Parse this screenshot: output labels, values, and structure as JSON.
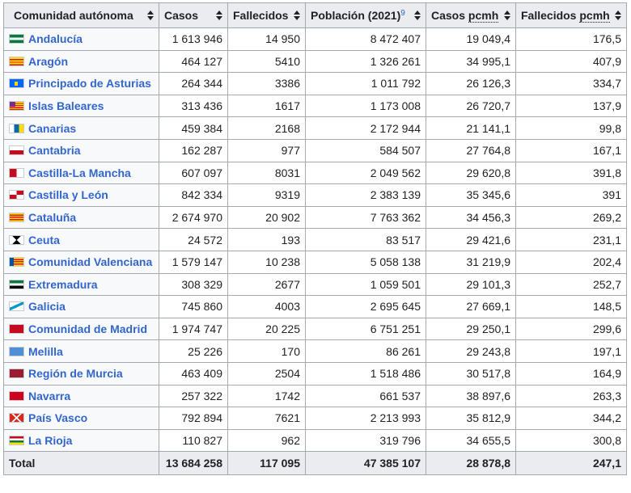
{
  "table": {
    "headers": [
      {
        "label": "Comunidad autónoma",
        "sup": "",
        "abbr": ""
      },
      {
        "label": "Casos",
        "sup": "",
        "abbr": ""
      },
      {
        "label": "Fallecidos",
        "sup": "",
        "abbr": ""
      },
      {
        "label": "Población (2021)",
        "sup": "9",
        "abbr": ""
      },
      {
        "label": "Casos ",
        "sup": "",
        "abbr": "pcmh"
      },
      {
        "label": "Fallecidos ",
        "sup": "",
        "abbr": "pcmh"
      }
    ],
    "rows": [
      {
        "flag": "andalucia-flag-icon",
        "flag_class": "f-andalucia",
        "name": "Andalucía",
        "casos": "1 613 946",
        "fallecidos": "14 950",
        "poblacion": "8 472 407",
        "casos_pcmh": "19 049,4",
        "fallecidos_pcmh": "176,5"
      },
      {
        "flag": "aragon-flag-icon",
        "flag_class": "f-aragon",
        "name": "Aragón",
        "casos": "464 127",
        "fallecidos": "5410",
        "poblacion": "1 326 261",
        "casos_pcmh": "34 995,1",
        "fallecidos_pcmh": "407,9"
      },
      {
        "flag": "asturias-flag-icon",
        "flag_class": "f-asturias",
        "name": "Principado de Asturias",
        "casos": "264 344",
        "fallecidos": "3386",
        "poblacion": "1 011 792",
        "casos_pcmh": "26 126,3",
        "fallecidos_pcmh": "334,7"
      },
      {
        "flag": "baleares-flag-icon",
        "flag_class": "f-baleares",
        "name": "Islas Baleares",
        "casos": "313 436",
        "fallecidos": "1617",
        "poblacion": "1 173 008",
        "casos_pcmh": "26 720,7",
        "fallecidos_pcmh": "137,9"
      },
      {
        "flag": "canarias-flag-icon",
        "flag_class": "f-canarias",
        "name": "Canarias",
        "casos": "459 384",
        "fallecidos": "2168",
        "poblacion": "2 172 944",
        "casos_pcmh": "21 141,1",
        "fallecidos_pcmh": "99,8"
      },
      {
        "flag": "cantabria-flag-icon",
        "flag_class": "f-cantabria",
        "name": "Cantabria",
        "casos": "162 287",
        "fallecidos": "977",
        "poblacion": "584 507",
        "casos_pcmh": "27 764,8",
        "fallecidos_pcmh": "167,1"
      },
      {
        "flag": "castilla-la-mancha-flag-icon",
        "flag_class": "f-clm",
        "name": "Castilla-La Mancha",
        "casos": "607 097",
        "fallecidos": "8031",
        "poblacion": "2 049 562",
        "casos_pcmh": "29 620,8",
        "fallecidos_pcmh": "391,8"
      },
      {
        "flag": "castilla-y-leon-flag-icon",
        "flag_class": "f-cyl",
        "name": "Castilla y León",
        "casos": "842 334",
        "fallecidos": "9319",
        "poblacion": "2 383 139",
        "casos_pcmh": "35 345,6",
        "fallecidos_pcmh": "391"
      },
      {
        "flag": "cataluna-flag-icon",
        "flag_class": "f-cataluna",
        "name": "Cataluña",
        "casos": "2 674 970",
        "fallecidos": "20 902",
        "poblacion": "7 763 362",
        "casos_pcmh": "34 456,3",
        "fallecidos_pcmh": "269,2"
      },
      {
        "flag": "ceuta-flag-icon",
        "flag_class": "f-ceuta",
        "name": "Ceuta",
        "casos": "24 572",
        "fallecidos": "193",
        "poblacion": "83 517",
        "casos_pcmh": "29 421,6",
        "fallecidos_pcmh": "231,1"
      },
      {
        "flag": "comunidad-valenciana-flag-icon",
        "flag_class": "f-valencia",
        "name": "Comunidad Valenciana",
        "casos": "1 579 147",
        "fallecidos": "10 238",
        "poblacion": "5 058 138",
        "casos_pcmh": "31 219,9",
        "fallecidos_pcmh": "202,4"
      },
      {
        "flag": "extremadura-flag-icon",
        "flag_class": "f-extremadura",
        "name": "Extremadura",
        "casos": "308 329",
        "fallecidos": "2677",
        "poblacion": "1 059 501",
        "casos_pcmh": "29 101,3",
        "fallecidos_pcmh": "252,7"
      },
      {
        "flag": "galicia-flag-icon",
        "flag_class": "f-galicia",
        "name": "Galicia",
        "casos": "745 860",
        "fallecidos": "4003",
        "poblacion": "2 695 645",
        "casos_pcmh": "27 669,1",
        "fallecidos_pcmh": "148,5"
      },
      {
        "flag": "comunidad-de-madrid-flag-icon",
        "flag_class": "f-madrid",
        "name": "Comunidad de Madrid",
        "casos": "1 974 747",
        "fallecidos": "20 225",
        "poblacion": "6 751 251",
        "casos_pcmh": "29 250,1",
        "fallecidos_pcmh": "299,6"
      },
      {
        "flag": "melilla-flag-icon",
        "flag_class": "f-melilla",
        "name": "Melilla",
        "casos": "25 226",
        "fallecidos": "170",
        "poblacion": "86 261",
        "casos_pcmh": "29 243,8",
        "fallecidos_pcmh": "197,1"
      },
      {
        "flag": "region-de-murcia-flag-icon",
        "flag_class": "f-murcia",
        "name": "Región de Murcia",
        "casos": "463 409",
        "fallecidos": "2504",
        "poblacion": "1 518 486",
        "casos_pcmh": "30 517,8",
        "fallecidos_pcmh": "164,9"
      },
      {
        "flag": "navarra-flag-icon",
        "flag_class": "f-navarra",
        "name": "Navarra",
        "casos": "257 322",
        "fallecidos": "1742",
        "poblacion": "661 537",
        "casos_pcmh": "38 897,6",
        "fallecidos_pcmh": "263,3"
      },
      {
        "flag": "pais-vasco-flag-icon",
        "flag_class": "f-paisvasco",
        "name": "País Vasco",
        "casos": "792 894",
        "fallecidos": "7621",
        "poblacion": "2 213 993",
        "casos_pcmh": "35 812,9",
        "fallecidos_pcmh": "344,2"
      },
      {
        "flag": "la-rioja-flag-icon",
        "flag_class": "f-larioja",
        "name": "La Rioja",
        "casos": "110 827",
        "fallecidos": "962",
        "poblacion": "319 796",
        "casos_pcmh": "34 655,5",
        "fallecidos_pcmh": "300,8"
      }
    ],
    "total": {
      "label": "Total",
      "casos": "13 684 258",
      "fallecidos": "117 095",
      "poblacion": "47 385 107",
      "casos_pcmh": "28 878,8",
      "fallecidos_pcmh": "247,1"
    },
    "colors": {
      "link": "#3366cc",
      "header_bg": "#eaecf0",
      "border": "#a2a9b1"
    }
  }
}
